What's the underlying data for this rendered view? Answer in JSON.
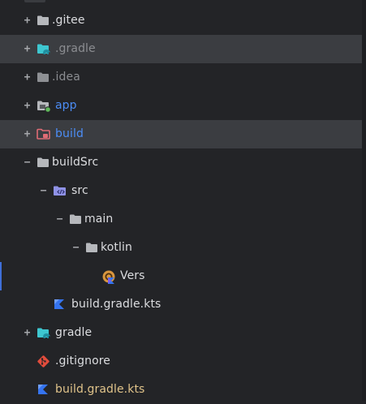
{
  "tree": {
    "items": [
      {
        "label": ".gitee",
        "toggle": "+",
        "icon": "folder-icon"
      },
      {
        "label": ".gradle",
        "toggle": "+",
        "icon": "gradle-folder-icon"
      },
      {
        "label": ".idea",
        "toggle": "+",
        "icon": "folder-icon"
      },
      {
        "label": "app",
        "toggle": "+",
        "icon": "module-folder-icon"
      },
      {
        "label": "build",
        "toggle": "+",
        "icon": "excluded-folder-icon"
      },
      {
        "label": "buildSrc",
        "toggle": "−",
        "icon": "folder-icon"
      },
      {
        "label": "src",
        "toggle": "−",
        "icon": "source-folder-icon"
      },
      {
        "label": "main",
        "toggle": "−",
        "icon": "folder-icon"
      },
      {
        "label": "kotlin",
        "toggle": "−",
        "icon": "folder-icon"
      },
      {
        "label": "Vers",
        "icon": "kotlin-object-icon"
      },
      {
        "label": "build.gradle.kts",
        "icon": "kotlin-file-icon"
      },
      {
        "label": "gradle",
        "toggle": "+",
        "icon": "gradle-folder-icon"
      },
      {
        "label": ".gitignore",
        "icon": "git-icon"
      },
      {
        "label": "build.gradle.kts",
        "icon": "kotlin-file-icon"
      }
    ]
  },
  "colors": {
    "background": "#232427",
    "selected_row": "#3b3d41",
    "folder": "#b6b8bc",
    "module_blue": "#4c8df6",
    "excluded_red": "#e06c75",
    "gradle_teal": "#3ec7d0",
    "kotlin_blue": "#3574f0",
    "git_red": "#e24c3c",
    "modified_gold": "#e0c38a",
    "dim_text": "#8b8d91"
  }
}
